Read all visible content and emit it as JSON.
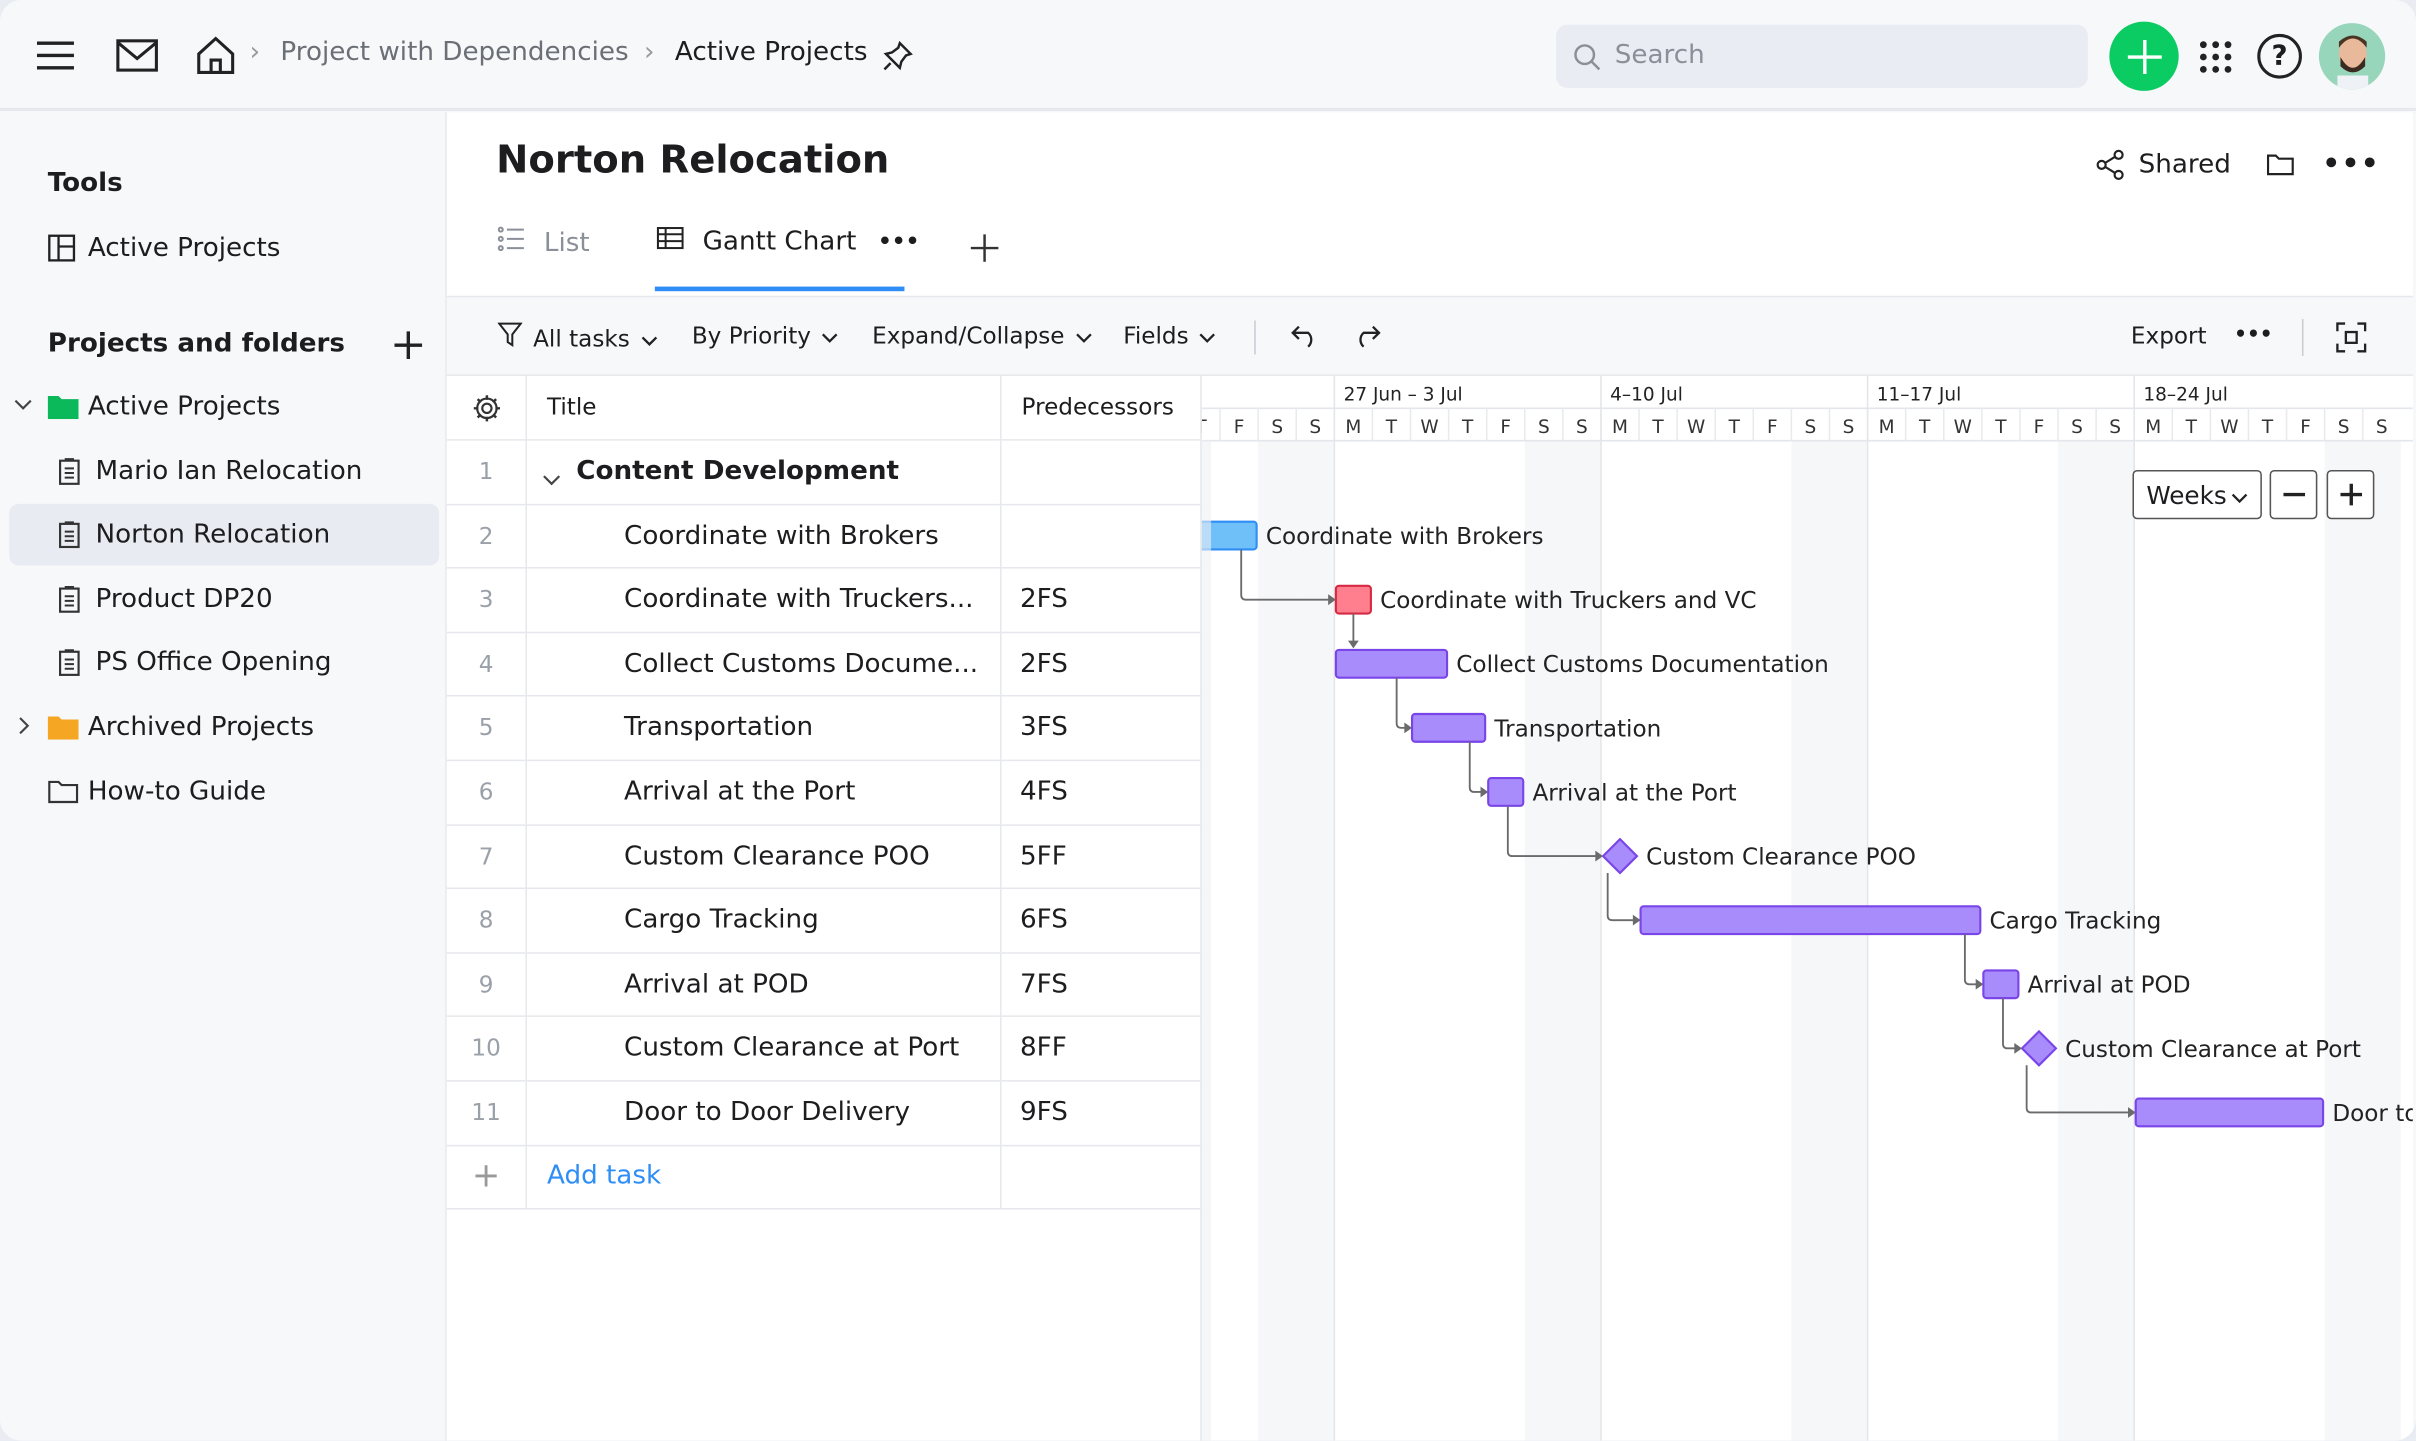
{
  "topbar": {
    "breadcrumb": [
      "Project with Dependencies",
      "Active Projects"
    ],
    "search_placeholder": "Search",
    "accent": "#0bcc62"
  },
  "sidebar": {
    "tools_heading": "Tools",
    "tools": [
      {
        "label": "Active Projects",
        "icon": "board-icon"
      }
    ],
    "projects_heading": "Projects and folders",
    "tree": [
      {
        "label": "Active Projects",
        "icon": "folder-green-icon",
        "expanded": true
      },
      {
        "label": "Mario Ian Relocation",
        "icon": "document-icon"
      },
      {
        "label": "Norton Relocation",
        "icon": "document-icon",
        "selected": true
      },
      {
        "label": "Product DP20",
        "icon": "document-icon"
      },
      {
        "label": "PS Office Opening",
        "icon": "document-icon"
      },
      {
        "label": "Archived Projects",
        "icon": "folder-orange-icon",
        "expanded": false
      },
      {
        "label": "How-to Guide",
        "icon": "folder-outline-icon"
      }
    ]
  },
  "header": {
    "title": "Norton Relocation",
    "shared_label": "Shared"
  },
  "tabs": [
    {
      "label": "List"
    },
    {
      "label": "Gantt Chart",
      "active": true
    }
  ],
  "toolbar": {
    "filter": "All tasks",
    "group": "By Priority",
    "expand": "Expand/Collapse",
    "fields": "Fields",
    "export": "Export"
  },
  "table": {
    "columns": [
      "Title",
      "Predecessors"
    ],
    "rows": [
      {
        "num": "1",
        "title": "Content Development",
        "pred": "",
        "group": true
      },
      {
        "num": "2",
        "title": "Coordinate with Brokers",
        "pred": ""
      },
      {
        "num": "3",
        "title": "Coordinate with Truckers...",
        "pred": "2FS"
      },
      {
        "num": "4",
        "title": "Collect Customs Docume...",
        "pred": "2FS"
      },
      {
        "num": "5",
        "title": "Transportation",
        "pred": "3FS"
      },
      {
        "num": "6",
        "title": "Arrival at the Port",
        "pred": "4FS"
      },
      {
        "num": "7",
        "title": "Custom Clearance POO",
        "pred": "5FF"
      },
      {
        "num": "8",
        "title": "Cargo Tracking",
        "pred": "6FS"
      },
      {
        "num": "9",
        "title": "Arrival at POD",
        "pred": "7FS"
      },
      {
        "num": "10",
        "title": "Custom Clearance at Port",
        "pred": "8FF"
      },
      {
        "num": "11",
        "title": "Door to Door Delivery",
        "pred": "9FS"
      }
    ],
    "add_task": "Add task"
  },
  "gantt": {
    "scale": "Weeks",
    "weeks": [
      "27 Jun – 3 Jul",
      "4–10 Jul",
      "11–17 Jul",
      "18–24 Jul"
    ],
    "day_letters": [
      "M",
      "T",
      "W",
      "T",
      "F",
      "S",
      "S"
    ],
    "colors": {
      "blue": "#6fbff9",
      "red": "#ff7f8e",
      "purple": "#a98cfb",
      "purple_border": "#7a45e8"
    }
  },
  "chart_data": {
    "type": "gantt",
    "tasks": [
      {
        "row": 2,
        "name": "Coordinate with Brokers",
        "start": "23 Jun",
        "end": "24 Jun",
        "color": "blue"
      },
      {
        "row": 3,
        "name": "Coordinate with Truckers and VC",
        "start": "27 Jun",
        "end": "27 Jun",
        "color": "red"
      },
      {
        "row": 4,
        "name": "Collect Customs Documentation",
        "start": "27 Jun",
        "end": "29 Jun",
        "color": "purple"
      },
      {
        "row": 5,
        "name": "Transportation",
        "start": "29 Jun",
        "end": "30 Jun",
        "color": "purple"
      },
      {
        "row": 6,
        "name": "Arrival at the Port",
        "start": "1 Jul",
        "end": "1 Jul",
        "color": "purple"
      },
      {
        "row": 7,
        "name": "Custom Clearance POO",
        "start": "4 Jul",
        "end": "4 Jul",
        "milestone": true,
        "color": "purple"
      },
      {
        "row": 8,
        "name": "Cargo Tracking",
        "start": "5 Jul",
        "end": "13 Jul",
        "color": "purple"
      },
      {
        "row": 9,
        "name": "Arrival at POD",
        "start": "14 Jul",
        "end": "14 Jul",
        "color": "purple"
      },
      {
        "row": 10,
        "name": "Custom Clearance at Port",
        "start": "15 Jul",
        "end": "15 Jul",
        "milestone": true,
        "color": "purple"
      },
      {
        "row": 11,
        "name": "Door to Door Delivery",
        "start": "18 Jul",
        "end": "22 Jul",
        "color": "purple"
      }
    ]
  }
}
